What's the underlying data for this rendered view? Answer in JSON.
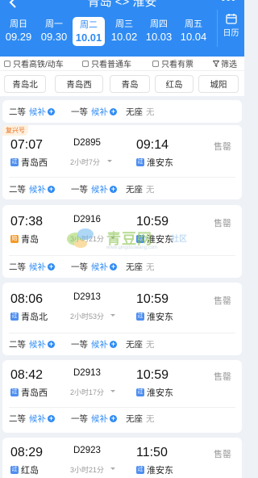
{
  "header": {
    "title": "青岛 <> 淮安",
    "more": "•••",
    "calendar_label": "日历"
  },
  "dates": [
    {
      "weekday": "周日",
      "date": "09.29",
      "active": false
    },
    {
      "weekday": "周一",
      "date": "09.30",
      "active": false
    },
    {
      "weekday": "周二",
      "date": "10.01",
      "active": true
    },
    {
      "weekday": "周三",
      "date": "10.02",
      "active": false
    },
    {
      "weekday": "周四",
      "date": "10.03",
      "active": false
    },
    {
      "weekday": "周五",
      "date": "10.04",
      "active": false
    }
  ],
  "filters": {
    "high_speed": "只看高铁/动车",
    "normal": "只看普通车",
    "has_ticket": "只看有票",
    "filter": "筛选"
  },
  "stations": [
    "青岛北",
    "青岛西",
    "青岛",
    "红岛",
    "城阳"
  ],
  "top_seats": {
    "second": "二等",
    "second_status": "候补",
    "first": "一等",
    "first_status": "候补",
    "none": "无座",
    "none_status": "无"
  },
  "trains": [
    {
      "badge": "复兴号",
      "dep_time": "07:07",
      "train_no": "D2895",
      "arr_time": "09:14",
      "dep_station": "青岛西",
      "dep_tag": "过",
      "duration": "2小时7分",
      "arr_station": "淮安东",
      "arr_tag": "过",
      "status": "售罄",
      "second": "二等",
      "second_status": "候补",
      "first": "一等",
      "first_status": "候补",
      "none": "无座",
      "none_status": "无"
    },
    {
      "badge": "",
      "dep_time": "07:38",
      "train_no": "D2916",
      "arr_time": "10:59",
      "dep_station": "青岛",
      "dep_tag": "始",
      "duration": "3小时21分",
      "arr_station": "淮安东",
      "arr_tag": "过",
      "status": "售罄",
      "second": "二等",
      "second_status": "候补",
      "first": "一等",
      "first_status": "候补",
      "none": "无座",
      "none_status": "无"
    },
    {
      "badge": "",
      "dep_time": "08:06",
      "train_no": "D2913",
      "arr_time": "10:59",
      "dep_station": "青岛北",
      "dep_tag": "过",
      "duration": "2小时53分",
      "arr_station": "淮安东",
      "arr_tag": "过",
      "status": "售罄",
      "second": "二等",
      "second_status": "候补",
      "first": "一等",
      "first_status": "候补",
      "none": "无座",
      "none_status": "无"
    },
    {
      "badge": "",
      "dep_time": "08:42",
      "train_no": "D2913",
      "arr_time": "10:59",
      "dep_station": "青岛西",
      "dep_tag": "过",
      "duration": "2小时17分",
      "arr_station": "淮安东",
      "arr_tag": "过",
      "status": "售罄",
      "second": "二等",
      "second_status": "候补",
      "first": "一等",
      "first_status": "候补",
      "none": "无座",
      "none_status": "无"
    },
    {
      "badge": "",
      "dep_time": "08:29",
      "train_no": "D2923",
      "arr_time": "11:50",
      "dep_station": "红岛",
      "dep_tag": "过",
      "duration": "3小时21分",
      "arr_station": "淮安东",
      "arr_tag": "过",
      "status": "售罄"
    }
  ],
  "watermark": {
    "name": "青豆网",
    "tag": "社区",
    "url": "www.qingdouwang.com"
  },
  "colors": {
    "primary": "#2f8bf3",
    "sold_out": "#9a9a9a",
    "badge": "#e0711c"
  }
}
